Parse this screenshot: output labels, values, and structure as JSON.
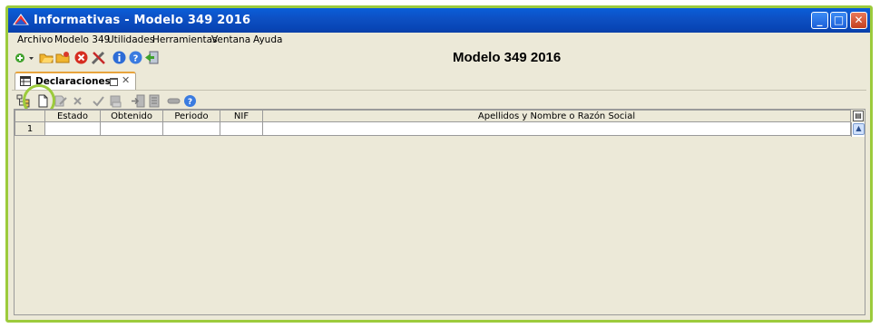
{
  "window": {
    "title": "Informativas - Modelo 349 2016",
    "min_glyph": "_",
    "max_glyph": "□",
    "close_glyph": "✕"
  },
  "menu": [
    "Archivo",
    "Modelo 349",
    "Utilidades",
    "Herramientas",
    "Ventana",
    "Ayuda"
  ],
  "toolbar": {
    "icons": [
      "add-dropdown-icon",
      "folder-open-icon",
      "folder-icon",
      "delete-icon",
      "tools-icon",
      "info-icon",
      "help-icon",
      "exit-icon"
    ]
  },
  "header": {
    "title": "Modelo 349 2016"
  },
  "tab": {
    "label": "Declaraciones",
    "close_glyph": "✕"
  },
  "declaraciones_toolbar": {
    "icons": [
      "tree-icon",
      "new-document-icon",
      "edit-document-icon",
      "delete-x-icon",
      "confirm-check-icon",
      "print-icon",
      "import-icon",
      "export-icon",
      "link-icon",
      "help-icon"
    ]
  },
  "table": {
    "columns": [
      "Estado",
      "Obtenido",
      "Periodo",
      "NIF",
      "Apellidos y Nombre o Razón Social"
    ],
    "rows": [
      {
        "num": "1",
        "cells": [
          "",
          "",
          "",
          "",
          ""
        ]
      }
    ]
  },
  "colors": {
    "accent": "#9ccb3c",
    "titlebar": "#0a4fc2",
    "window_bg": "#ece9d8"
  }
}
